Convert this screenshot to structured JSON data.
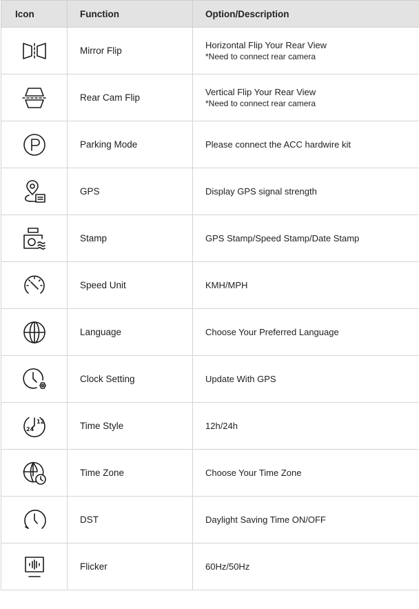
{
  "headers": {
    "icon": "Icon",
    "function": "Function",
    "description": "Option/Description"
  },
  "rows": [
    {
      "icon": "mirror-flip-icon",
      "function": "Mirror Flip",
      "description": "Horizontal Flip Your Rear View",
      "note": "*Need to connect rear camera"
    },
    {
      "icon": "rear-cam-flip-icon",
      "function": "Rear Cam Flip",
      "description": "Vertical Flip Your Rear View",
      "note": "*Need to connect rear camera"
    },
    {
      "icon": "parking-mode-icon",
      "function": "Parking Mode",
      "description": "Please connect the ACC hardwire kit"
    },
    {
      "icon": "gps-icon",
      "function": "GPS",
      "description": "Display GPS signal strength"
    },
    {
      "icon": "stamp-icon",
      "function": "Stamp",
      "description": "GPS Stamp/Speed Stamp/Date Stamp"
    },
    {
      "icon": "speed-unit-icon",
      "function": "Speed Unit",
      "description": "KMH/MPH"
    },
    {
      "icon": "language-icon",
      "function": "Language",
      "description": "Choose Your Preferred Language"
    },
    {
      "icon": "clock-setting-icon",
      "function": "Clock Setting",
      "description": "Update With GPS"
    },
    {
      "icon": "time-style-icon",
      "function": "Time Style",
      "description": "12h/24h",
      "icon_text": [
        "24",
        "12"
      ]
    },
    {
      "icon": "time-zone-icon",
      "function": "Time Zone",
      "description": "Choose Your Time Zone"
    },
    {
      "icon": "dst-icon",
      "function": "DST",
      "description": "Daylight Saving Time ON/OFF"
    },
    {
      "icon": "flicker-icon",
      "function": "Flicker",
      "description": "60Hz/50Hz"
    }
  ]
}
